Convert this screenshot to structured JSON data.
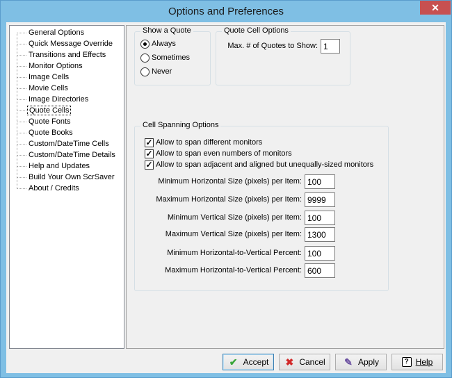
{
  "window": {
    "title": "Options and Preferences",
    "close_glyph": "✕"
  },
  "tree": {
    "items": [
      {
        "label": "General Options"
      },
      {
        "label": "Quick Message Override"
      },
      {
        "label": "Transitions and Effects"
      },
      {
        "label": "Monitor Options"
      },
      {
        "label": "Image Cells"
      },
      {
        "label": "Movie Cells"
      },
      {
        "label": "Image Directories"
      },
      {
        "label": "Quote Cells",
        "selected": true
      },
      {
        "label": "Quote Fonts"
      },
      {
        "label": "Quote Books"
      },
      {
        "label": "Custom/DateTime Cells"
      },
      {
        "label": "Custom/DateTime Details"
      },
      {
        "label": "Help and Updates"
      },
      {
        "label": "Build Your Own ScrSaver"
      },
      {
        "label": "About / Credits"
      }
    ]
  },
  "show_quote": {
    "title": "Show a Quote",
    "options": [
      {
        "label": "Always",
        "selected": true
      },
      {
        "label": "Sometimes",
        "selected": false
      },
      {
        "label": "Never",
        "selected": false
      }
    ]
  },
  "quote_cell": {
    "title": "Quote Cell Options",
    "max_label": "Max. # of Quotes to Show:",
    "max_value": "1"
  },
  "spanning": {
    "title": "Cell Spanning Options",
    "checks": [
      {
        "label": "Allow to span different monitors",
        "checked": true
      },
      {
        "label": "Allow to span even numbers of monitors",
        "checked": true
      },
      {
        "label": "Allow to span adjacent and aligned but unequally-sized monitors",
        "checked": true
      }
    ],
    "fields": [
      {
        "label": "Minimum Horizontal Size (pixels) per Item:",
        "value": "100"
      },
      {
        "label": "Maximum Horizontal Size (pixels) per Item:",
        "value": "9999"
      },
      {
        "label": "Minimum Vertical Size (pixels) per Item:",
        "value": "100"
      },
      {
        "label": "Maximum Vertical Size (pixels) per Item:",
        "value": "1300"
      },
      {
        "label": "Minimum Horizontal-to-Vertical  Percent:",
        "value": "100"
      },
      {
        "label": "Maximum Horizontal-to-Vertical  Percent:",
        "value": "600"
      }
    ]
  },
  "buttons": {
    "accept": "Accept",
    "cancel": "Cancel",
    "apply": "Apply",
    "help": "Help"
  }
}
